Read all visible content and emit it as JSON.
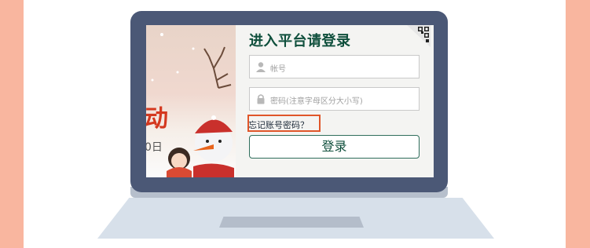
{
  "login": {
    "title": "进入平台请登录",
    "account_placeholder": "帐号",
    "password_placeholder": "密码(注意字母区分大小写)",
    "forgot_label": "忘记账号密码？",
    "login_button": "登录"
  },
  "hero": {
    "text_fragment": "动",
    "date_fragment": "0日"
  },
  "icons": {
    "account": "user-icon",
    "password": "lock-icon",
    "qr": "qr-code-icon"
  },
  "colors": {
    "accent": "#0f4f3c",
    "highlight": "#e0562a",
    "laptop": "#4b5876",
    "side_bars": "#f9b69f"
  }
}
